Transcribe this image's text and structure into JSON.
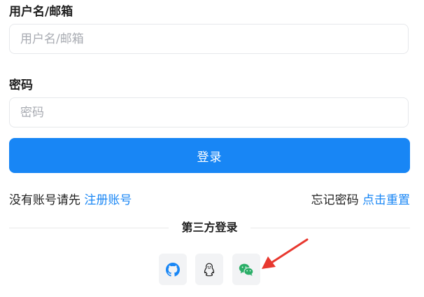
{
  "form": {
    "username_label": "用户名/邮箱",
    "username_placeholder": "用户名/邮箱",
    "username_value": "",
    "password_label": "密码",
    "password_placeholder": "密码",
    "password_value": "",
    "login_label": "登录"
  },
  "links": {
    "register_prompt": "没有账号请先",
    "register_link": "注册账号",
    "forgot_prompt": "忘记密码",
    "reset_link": "点击重置"
  },
  "third_party": {
    "title": "第三方登录",
    "providers": [
      {
        "name": "github",
        "icon": "github-icon"
      },
      {
        "name": "qq",
        "icon": "qq-penguin-icon"
      },
      {
        "name": "wechat",
        "icon": "wechat-icon"
      }
    ]
  },
  "colors": {
    "primary": "#1886f5",
    "annotation": "#e8382f",
    "wechat": "#2aae67"
  }
}
